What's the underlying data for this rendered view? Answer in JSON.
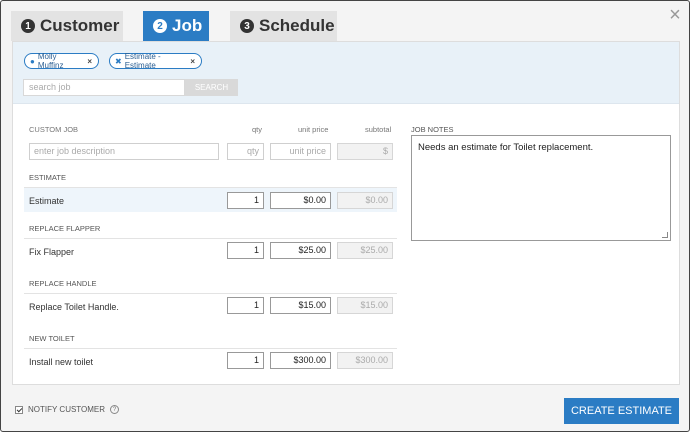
{
  "tabs": [
    {
      "num": "1",
      "label": "Customer"
    },
    {
      "num": "2",
      "label": "Job"
    },
    {
      "num": "3",
      "label": "Schedule"
    }
  ],
  "close_glyph": "×",
  "chips": [
    {
      "label": "Molly Muffinz",
      "icon": "person-icon",
      "remove": "×"
    },
    {
      "label": "Estimate - Estimate",
      "icon": "tools-icon",
      "remove": "×"
    }
  ],
  "search": {
    "placeholder": "search job",
    "button": "SEARCH"
  },
  "table": {
    "headers": {
      "custom_job": "CUSTOM JOB",
      "qty": "qty",
      "unit_price": "unit price",
      "subtotal": "subtotal"
    },
    "custom_row": {
      "description_placeholder": "enter job description",
      "qty_placeholder": "qty",
      "price_placeholder": "unit price",
      "subtotal": "$"
    },
    "sections": [
      {
        "label": "ESTIMATE",
        "item": "Estimate",
        "qty": "1",
        "price": "$0.00",
        "subtotal": "$0.00"
      },
      {
        "label": "REPLACE FLAPPER",
        "item": "Fix Flapper",
        "qty": "1",
        "price": "$25.00",
        "subtotal": "$25.00"
      },
      {
        "label": "REPLACE HANDLE",
        "item": "Replace Toilet Handle.",
        "qty": "1",
        "price": "$15.00",
        "subtotal": "$15.00"
      },
      {
        "label": "NEW TOILET",
        "item": "Install new toilet",
        "qty": "1",
        "price": "$300.00",
        "subtotal": "$300.00"
      }
    ]
  },
  "notes": {
    "label": "JOB NOTES",
    "text": "Needs an estimate for Toilet replacement."
  },
  "footer": {
    "notify_label": "NOTIFY CUSTOMER",
    "help": "?",
    "create_button": "CREATE ESTIMATE"
  },
  "colors": {
    "accent": "#2b7cc4"
  }
}
